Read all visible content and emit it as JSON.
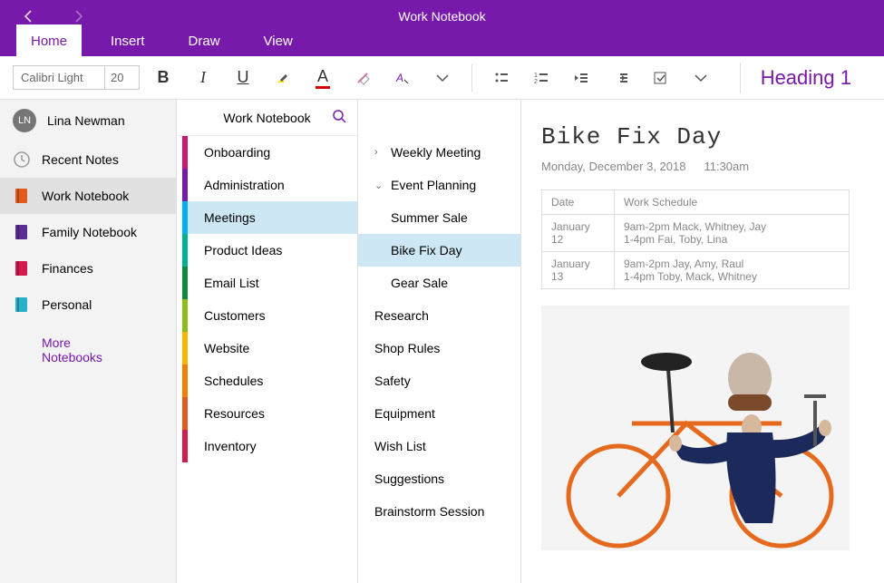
{
  "title": "Work Notebook",
  "tabs": {
    "home": "Home",
    "insert": "Insert",
    "draw": "Draw",
    "view": "View"
  },
  "font": {
    "name": "Calibri Light",
    "size": "20"
  },
  "heading_style": "Heading 1",
  "user": {
    "initials": "LN",
    "name": "Lina Newman"
  },
  "sidebar": {
    "recent": "Recent Notes",
    "notebooks": [
      {
        "label": "Work Notebook",
        "color": "#e05b1d",
        "active": true
      },
      {
        "label": "Family Notebook",
        "color": "#5b2d90"
      },
      {
        "label": "Finances",
        "color": "#d41b4d"
      },
      {
        "label": "Personal",
        "color": "#29b0c8"
      }
    ],
    "more": "More Notebooks"
  },
  "sections_header": "Work Notebook",
  "sections": [
    {
      "label": "Onboarding",
      "color": "#c9186f"
    },
    {
      "label": "Administration",
      "color": "#7719AA"
    },
    {
      "label": "Meetings",
      "color": "#00b0f0",
      "active": true
    },
    {
      "label": "Product Ideas",
      "color": "#00b294"
    },
    {
      "label": "Email List",
      "color": "#10893e"
    },
    {
      "label": "Customers",
      "color": "#8cbd18"
    },
    {
      "label": "Website",
      "color": "#f7b500"
    },
    {
      "label": "Schedules",
      "color": "#f08000"
    },
    {
      "label": "Resources",
      "color": "#e05b1d"
    },
    {
      "label": "Inventory",
      "color": "#d41b4d"
    }
  ],
  "pages": [
    {
      "label": "Weekly Meeting",
      "chev": "right"
    },
    {
      "label": "Event Planning",
      "chev": "down"
    },
    {
      "label": "Summer Sale",
      "indent": true
    },
    {
      "label": "Bike Fix Day",
      "indent": true,
      "active": true
    },
    {
      "label": "Gear Sale",
      "indent": true
    },
    {
      "label": "Research"
    },
    {
      "label": "Shop Rules"
    },
    {
      "label": "Safety"
    },
    {
      "label": "Equipment"
    },
    {
      "label": "Wish List"
    },
    {
      "label": "Suggestions"
    },
    {
      "label": "Brainstorm Session"
    }
  ],
  "canvas": {
    "title": "Bike Fix Day",
    "date": "Monday, December 3, 2018",
    "time": "11:30am",
    "table": {
      "headers": [
        "Date",
        "Work Schedule"
      ],
      "rows": [
        [
          "January 12",
          "9am-2pm Mack, Whitney, Jay\n1-4pm Fai, Toby, Lina"
        ],
        [
          "January 13",
          "9am-2pm Jay, Amy, Raul\n1-4pm Toby, Mack, Whitney"
        ]
      ]
    }
  }
}
